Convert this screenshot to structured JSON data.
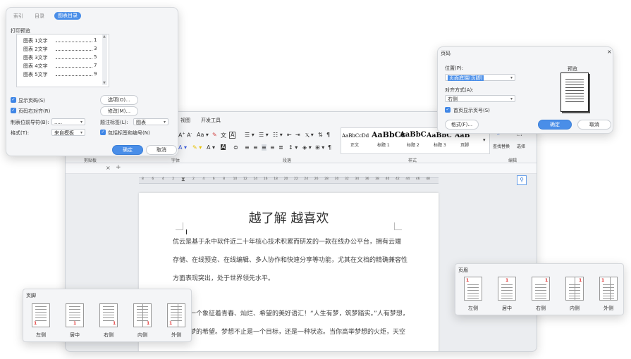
{
  "toc_dialog": {
    "tabs": [
      "索引",
      "目录",
      "图表目录"
    ],
    "print_preview_label": "打印预览",
    "entries": [
      {
        "label": "图表 1文字",
        "page": "1"
      },
      {
        "label": "图表 2文字",
        "page": "3"
      },
      {
        "label": "图表 3文字",
        "page": "5"
      },
      {
        "label": "图表 4文字",
        "page": "7"
      },
      {
        "label": "图表 5文字",
        "page": "9"
      }
    ],
    "show_page_numbers": "显示页码(S)",
    "right_align_page_numbers": "页码右对齐(R)",
    "tab_leader_label": "制表位前导符(B):",
    "tab_leader_value": ".....",
    "format_label": "格式(T):",
    "format_value": "来自模板",
    "caption_label_label": "题注标签(L):",
    "caption_label_value": "图表",
    "include_label_and_number": "包括标签和编号(N)",
    "options_button": "选项(O)...",
    "modify_button": "修改(M)...",
    "ok_button": "确定",
    "cancel_button": "取消"
  },
  "page_number_dialog": {
    "title": "页码",
    "position_label": "位置(P):",
    "position_value": "页面底端(页脚)",
    "alignment_label": "对齐方式(A):",
    "alignment_value": "右侧",
    "first_page_label": "首页显示页号(S)",
    "preview_label": "预览",
    "format_button": "格式(F)...",
    "ok_button": "确定",
    "cancel_button": "取消"
  },
  "main_window": {
    "ribbon_tabs": [
      "视图",
      "开发工具"
    ],
    "styles": [
      {
        "sample": "AaBbCcDd",
        "label": "正文"
      },
      {
        "sample": "AaBbCc",
        "label": "标题 1"
      },
      {
        "sample": "AaBbC",
        "label": "标题 2"
      },
      {
        "sample": "AaBbC",
        "label": "标题 3"
      },
      {
        "sample": "AaB",
        "label": "页脚"
      }
    ],
    "find_replace_label": "查找替换",
    "select_label": "选择",
    "group_clipboard": "剪贴板",
    "group_font": "字体",
    "group_paragraph": "段落",
    "group_styles": "样式",
    "group_editing": "编辑",
    "doc_title": "越了解 越喜欢",
    "para1_line1": "优云是基于永中软件近二十年核心技术积累而研发的一款在线办公平台，拥有云端",
    "para1_line2": "存储、在线预览、在线编辑、多人协作和快速分享等功能，尤其在文档的精确兼容性",
    "para1_line3": "方面表现突出，处于世界领先水平。",
    "para2_line1": "一个象征着青春、灿烂、希望的美好语汇！“人生有梦，筑梦踏实。”人有梦想，",
    "para2_line2": "梦的希望。梦想不止是一个目标，还是一种状态。当你高举梦想的火炬，天空",
    "ruler_numbers": [
      "8",
      "6",
      "4",
      "2",
      "",
      "2",
      "4",
      "6",
      "8",
      "10",
      "12",
      "14",
      "16",
      "18",
      "20",
      "22",
      "24",
      "26",
      "28",
      "30",
      "32",
      "34",
      "36",
      "38",
      "40",
      "42",
      "44",
      "46",
      "48"
    ]
  },
  "header_panel": {
    "title": "页眉",
    "options": [
      "左侧",
      "居中",
      "右侧",
      "内侧",
      "外侧"
    ]
  },
  "footer_panel": {
    "title": "页脚",
    "options": [
      "左侧",
      "居中",
      "右侧",
      "内侧",
      "外侧"
    ]
  },
  "colors": {
    "accent": "#4a8ee8",
    "page_number": "#e03030"
  }
}
